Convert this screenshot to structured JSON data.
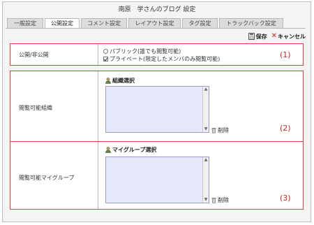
{
  "window": {
    "title": "南原　学さんのブログ 設定"
  },
  "tabs": [
    {
      "label": "一般設定",
      "active": false
    },
    {
      "label": "公開設定",
      "active": true
    },
    {
      "label": "コメント設定",
      "active": false
    },
    {
      "label": "レイアウト設定",
      "active": false
    },
    {
      "label": "タグ設定",
      "active": false
    },
    {
      "label": "トラックバック設定",
      "active": false
    }
  ],
  "actions": {
    "save_label": "保存",
    "cancel_label": "キャンセル"
  },
  "sections": {
    "visibility": {
      "label": "公開/非公開",
      "marker": "(1)",
      "options": [
        {
          "label": "パブリック(誰でも閲覧可能)",
          "type": "radio",
          "checked": false
        },
        {
          "label": "プライベート(限定したメンバのみ閲覧可能)",
          "type": "checkbox",
          "checked": true
        }
      ]
    },
    "org": {
      "label": "閲覧可能組織",
      "marker": "(2)",
      "select_label": "組織選択",
      "delete_label": "削除"
    },
    "groups": {
      "label": "閲覧可能マイグループ",
      "marker": "(3)",
      "select_label": "マイグループ選択",
      "delete_label": "削除"
    }
  },
  "colors": {
    "highlight_border": "#e53d3d",
    "marker": "#d42020",
    "listbox_bg": "#e6e8fb"
  }
}
